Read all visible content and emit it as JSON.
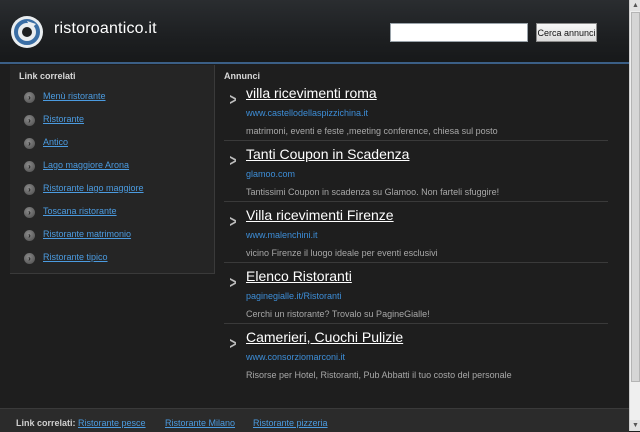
{
  "header": {
    "site_title": "ristoroantico.it",
    "search_placeholder": "",
    "search_button": "Cerca annunci",
    "logo_icon": "circular-arrow-logo-icon"
  },
  "sidebar": {
    "title": "Link correlati",
    "items": [
      {
        "label": "Menù ristorante"
      },
      {
        "label": "Ristorante"
      },
      {
        "label": "Antico"
      },
      {
        "label": "Lago maggiore Arona"
      },
      {
        "label": "Ristorante lago maggiore"
      },
      {
        "label": "Toscana ristorante"
      },
      {
        "label": "Ristorante matrimonio"
      },
      {
        "label": "Ristorante tipico"
      }
    ]
  },
  "main": {
    "title": "Annunci",
    "ads": [
      {
        "title": "villa ricevimenti roma",
        "url": "www.castellodellaspizzichina.it",
        "desc": "matrimoni, eventi e feste ,meeting conference, chiesa sul posto"
      },
      {
        "title": "Tanti Coupon in Scadenza",
        "url": "glamoo.com",
        "desc": "Tantissimi Coupon in scadenza su Glamoo. Non farteli sfuggire!"
      },
      {
        "title": "Villa ricevimenti Firenze",
        "url": "www.malenchini.it",
        "desc": "vicino Firenze il luogo ideale per eventi esclusivi"
      },
      {
        "title": "Elenco Ristoranti",
        "url": "paginegialle.it/Ristoranti",
        "desc": "Cerchi un ristorante? Trovalo su PagineGialle!"
      },
      {
        "title": "Camerieri, Cuochi Pulizie",
        "url": "www.consorziomarconi.it",
        "desc": "Risorse per Hotel, Ristoranti, Pub Abbatti il tuo costo del personale"
      }
    ]
  },
  "footer": {
    "label": "Link correlati:",
    "links": [
      "Ristorante pesce",
      "Ristorante Milano",
      "Ristorante pizzeria"
    ]
  },
  "colors": {
    "background": "#1e1e1e",
    "link": "#4b9be0",
    "accent_border": "#3b5f86"
  }
}
